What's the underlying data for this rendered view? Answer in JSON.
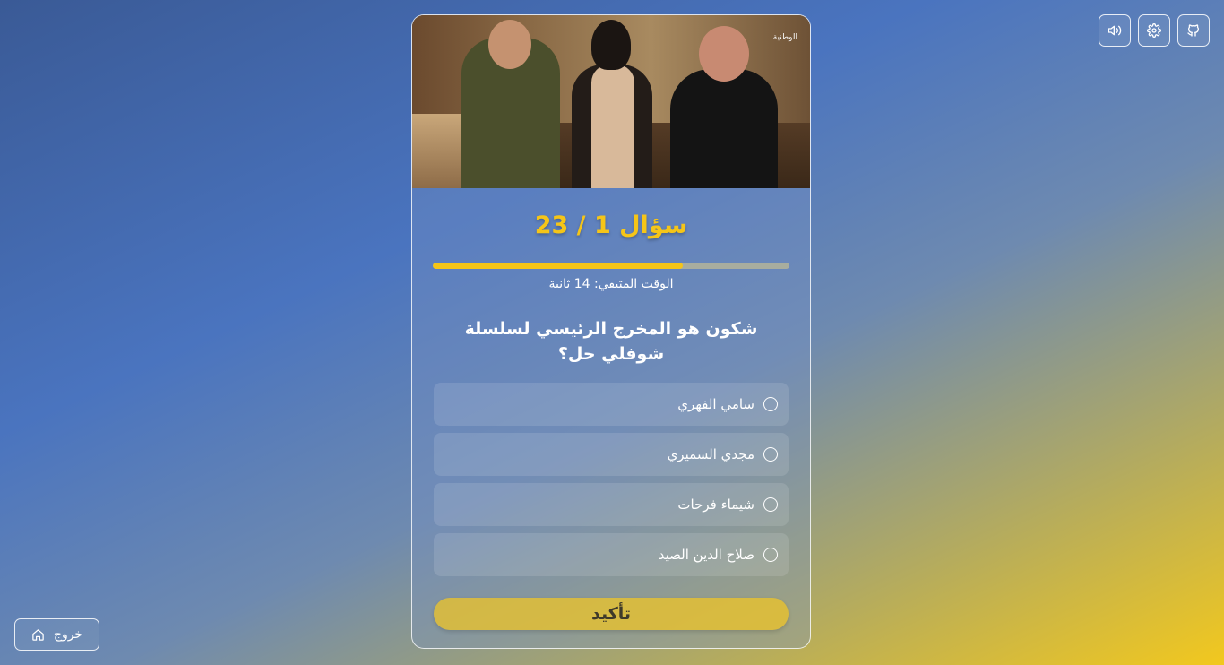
{
  "toolbar": {
    "buttons": [
      {
        "icon": "github-icon"
      },
      {
        "icon": "gear-icon"
      },
      {
        "icon": "volume-icon"
      }
    ]
  },
  "hero": {
    "channel_logo": "الوطنية"
  },
  "quiz": {
    "title": "سؤال 1 / 23",
    "progress": 0.7,
    "timer_text": "الوقت المتبقي: 14 ثانية",
    "question": "شكون هو المخرج الرئيسي لسلسلة شوفلي حل؟",
    "options": [
      "سامي الفهري",
      "مجدي السميري",
      "شيماء فرحات",
      "صلاح الدين الصيد"
    ],
    "confirm_label": "تأكيد"
  },
  "exit": {
    "label": "خروج",
    "icon": "home-icon"
  },
  "colors": {
    "accent": "#f5c518"
  }
}
